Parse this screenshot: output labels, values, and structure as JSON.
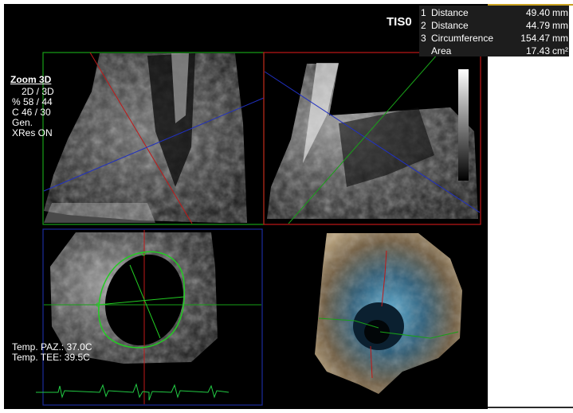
{
  "status_info": {
    "mode": "Zoom 3D",
    "lines": [
      "2D / 3D",
      "% 58 / 44",
      "C  46 / 30",
      "Gen.",
      "XRes ON"
    ]
  },
  "probe_label": "TIS0",
  "measurements": [
    {
      "index": "1",
      "name": "Distance",
      "value": "49.40",
      "unit": "mm"
    },
    {
      "index": "2",
      "name": "Distance",
      "value": "44.79",
      "unit": "mm"
    },
    {
      "index": "3",
      "name": "Circumference",
      "value": "154.47",
      "unit": "mm"
    },
    {
      "index": "",
      "name": "Area",
      "value": "17.43",
      "unit": "cm²"
    }
  ],
  "temperatures": {
    "patient": "Temp. PAZ.: 37.0C",
    "tee": "Temp. TEE: 39.5C"
  },
  "panel_colors": {
    "top_left": "#18a018",
    "top_right": "#c01818",
    "bottom_left": "#1c2c9c",
    "measure_contour": "#22cc22",
    "ecg_trace": "#22cc44"
  }
}
